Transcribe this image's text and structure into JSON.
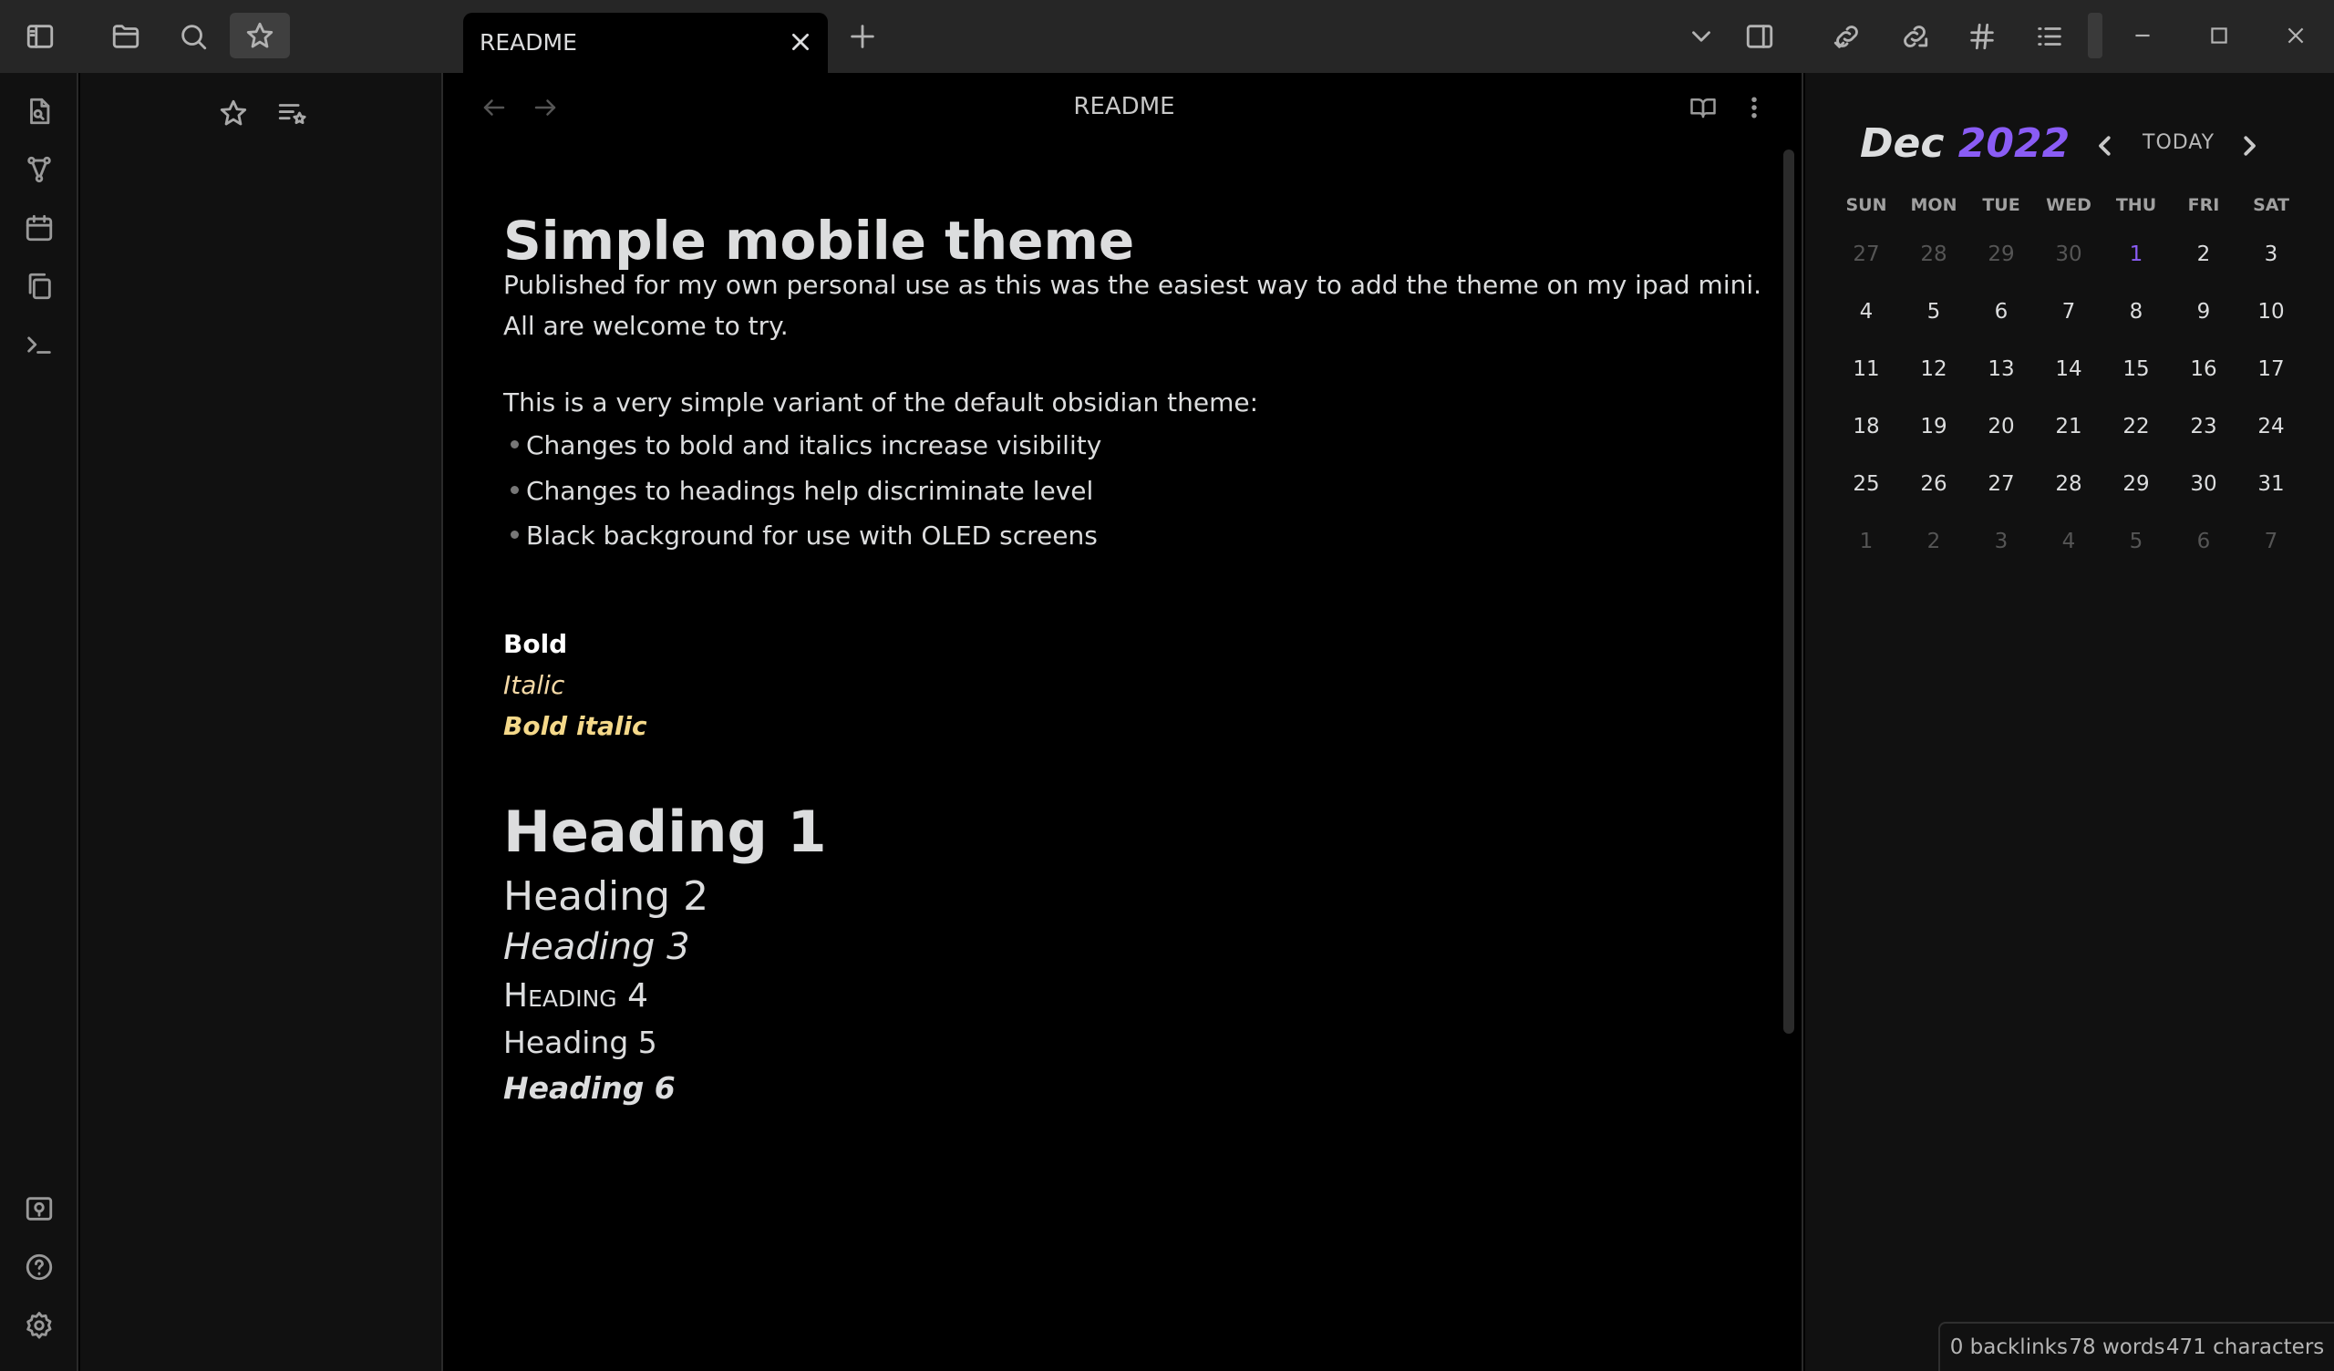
{
  "tabs": [
    {
      "label": "README"
    }
  ],
  "view": {
    "title": "README"
  },
  "document": {
    "title": "Simple mobile theme",
    "intro_line1": "Published for my own personal use as this was the easiest way to add the theme on my ipad mini.",
    "intro_line2": "All are welcome to try.",
    "variant_line": "This is a very simple variant of the default obsidian theme:",
    "bullets": [
      "Changes to bold and italics increase visibility",
      "Changes to headings help discriminate level",
      "Black background for use with OLED screens"
    ],
    "bold": "Bold",
    "italic": "Italic",
    "bold_italic": "Bold italic",
    "headings": [
      "Heading 1",
      "Heading 2",
      "Heading 3",
      "Heading 4",
      "Heading 5",
      "Heading 6"
    ]
  },
  "calendar": {
    "month": "Dec",
    "year": "2022",
    "today_label": "TODAY",
    "days_of_week": [
      "SUN",
      "MON",
      "TUE",
      "WED",
      "THU",
      "FRI",
      "SAT"
    ],
    "weeks": [
      [
        "27",
        "28",
        "29",
        "30",
        "1",
        "2",
        "3"
      ],
      [
        "4",
        "5",
        "6",
        "7",
        "8",
        "9",
        "10"
      ],
      [
        "11",
        "12",
        "13",
        "14",
        "15",
        "16",
        "17"
      ],
      [
        "18",
        "19",
        "20",
        "21",
        "22",
        "23",
        "24"
      ],
      [
        "25",
        "26",
        "27",
        "28",
        "29",
        "30",
        "31"
      ],
      [
        "1",
        "2",
        "3",
        "4",
        "5",
        "6",
        "7"
      ]
    ],
    "accent_color": "#8a5cf5"
  },
  "status": {
    "backlinks": "0 backlinks",
    "words": "78 words",
    "characters": "471 characters"
  },
  "icons": {
    "titlebar": [
      "sidebar-toggle-icon",
      "folder-icon",
      "search-icon",
      "star-icon",
      "plus-icon",
      "chevron-down-icon",
      "right-sidebar-icon",
      "backlinks-icon",
      "outgoing-links-icon",
      "hashtag-icon",
      "outline-icon"
    ],
    "ribbon": [
      "file-switcher-icon",
      "graph-icon",
      "calendar-icon",
      "copy-icon",
      "terminal-icon",
      "vault-icon",
      "help-icon",
      "settings-icon"
    ],
    "left_panel": [
      "star-icon",
      "bookmark-list-icon"
    ],
    "view_header": [
      "back-arrow-icon",
      "forward-arrow-icon",
      "reading-view-icon",
      "more-options-icon"
    ]
  }
}
